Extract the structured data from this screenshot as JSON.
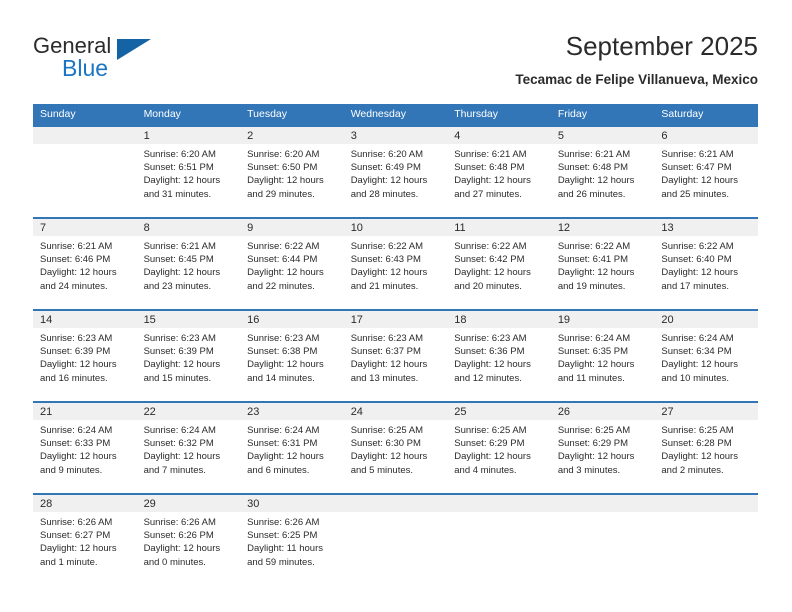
{
  "logo": {
    "word_top": "General",
    "word_bottom": "Blue",
    "triangle_color": "#1464a5",
    "blue_color": "#1a75c4"
  },
  "header": {
    "title": "September 2025",
    "subtitle": "Tecamac de Felipe Villanueva, Mexico"
  },
  "theme": {
    "header_blue": "#3276b8",
    "daynum_band": "#f0f0f0",
    "text": "#2b2b2b"
  },
  "weekday_headers": [
    "Sunday",
    "Monday",
    "Tuesday",
    "Wednesday",
    "Thursday",
    "Friday",
    "Saturday"
  ],
  "weeks": [
    [
      {
        "day": "",
        "sunrise": "",
        "sunset": "",
        "daylight1": "",
        "daylight2": ""
      },
      {
        "day": "1",
        "sunrise": "Sunrise: 6:20 AM",
        "sunset": "Sunset: 6:51 PM",
        "daylight1": "Daylight: 12 hours",
        "daylight2": "and 31 minutes."
      },
      {
        "day": "2",
        "sunrise": "Sunrise: 6:20 AM",
        "sunset": "Sunset: 6:50 PM",
        "daylight1": "Daylight: 12 hours",
        "daylight2": "and 29 minutes."
      },
      {
        "day": "3",
        "sunrise": "Sunrise: 6:20 AM",
        "sunset": "Sunset: 6:49 PM",
        "daylight1": "Daylight: 12 hours",
        "daylight2": "and 28 minutes."
      },
      {
        "day": "4",
        "sunrise": "Sunrise: 6:21 AM",
        "sunset": "Sunset: 6:48 PM",
        "daylight1": "Daylight: 12 hours",
        "daylight2": "and 27 minutes."
      },
      {
        "day": "5",
        "sunrise": "Sunrise: 6:21 AM",
        "sunset": "Sunset: 6:48 PM",
        "daylight1": "Daylight: 12 hours",
        "daylight2": "and 26 minutes."
      },
      {
        "day": "6",
        "sunrise": "Sunrise: 6:21 AM",
        "sunset": "Sunset: 6:47 PM",
        "daylight1": "Daylight: 12 hours",
        "daylight2": "and 25 minutes."
      }
    ],
    [
      {
        "day": "7",
        "sunrise": "Sunrise: 6:21 AM",
        "sunset": "Sunset: 6:46 PM",
        "daylight1": "Daylight: 12 hours",
        "daylight2": "and 24 minutes."
      },
      {
        "day": "8",
        "sunrise": "Sunrise: 6:21 AM",
        "sunset": "Sunset: 6:45 PM",
        "daylight1": "Daylight: 12 hours",
        "daylight2": "and 23 minutes."
      },
      {
        "day": "9",
        "sunrise": "Sunrise: 6:22 AM",
        "sunset": "Sunset: 6:44 PM",
        "daylight1": "Daylight: 12 hours",
        "daylight2": "and 22 minutes."
      },
      {
        "day": "10",
        "sunrise": "Sunrise: 6:22 AM",
        "sunset": "Sunset: 6:43 PM",
        "daylight1": "Daylight: 12 hours",
        "daylight2": "and 21 minutes."
      },
      {
        "day": "11",
        "sunrise": "Sunrise: 6:22 AM",
        "sunset": "Sunset: 6:42 PM",
        "daylight1": "Daylight: 12 hours",
        "daylight2": "and 20 minutes."
      },
      {
        "day": "12",
        "sunrise": "Sunrise: 6:22 AM",
        "sunset": "Sunset: 6:41 PM",
        "daylight1": "Daylight: 12 hours",
        "daylight2": "and 19 minutes."
      },
      {
        "day": "13",
        "sunrise": "Sunrise: 6:22 AM",
        "sunset": "Sunset: 6:40 PM",
        "daylight1": "Daylight: 12 hours",
        "daylight2": "and 17 minutes."
      }
    ],
    [
      {
        "day": "14",
        "sunrise": "Sunrise: 6:23 AM",
        "sunset": "Sunset: 6:39 PM",
        "daylight1": "Daylight: 12 hours",
        "daylight2": "and 16 minutes."
      },
      {
        "day": "15",
        "sunrise": "Sunrise: 6:23 AM",
        "sunset": "Sunset: 6:39 PM",
        "daylight1": "Daylight: 12 hours",
        "daylight2": "and 15 minutes."
      },
      {
        "day": "16",
        "sunrise": "Sunrise: 6:23 AM",
        "sunset": "Sunset: 6:38 PM",
        "daylight1": "Daylight: 12 hours",
        "daylight2": "and 14 minutes."
      },
      {
        "day": "17",
        "sunrise": "Sunrise: 6:23 AM",
        "sunset": "Sunset: 6:37 PM",
        "daylight1": "Daylight: 12 hours",
        "daylight2": "and 13 minutes."
      },
      {
        "day": "18",
        "sunrise": "Sunrise: 6:23 AM",
        "sunset": "Sunset: 6:36 PM",
        "daylight1": "Daylight: 12 hours",
        "daylight2": "and 12 minutes."
      },
      {
        "day": "19",
        "sunrise": "Sunrise: 6:24 AM",
        "sunset": "Sunset: 6:35 PM",
        "daylight1": "Daylight: 12 hours",
        "daylight2": "and 11 minutes."
      },
      {
        "day": "20",
        "sunrise": "Sunrise: 6:24 AM",
        "sunset": "Sunset: 6:34 PM",
        "daylight1": "Daylight: 12 hours",
        "daylight2": "and 10 minutes."
      }
    ],
    [
      {
        "day": "21",
        "sunrise": "Sunrise: 6:24 AM",
        "sunset": "Sunset: 6:33 PM",
        "daylight1": "Daylight: 12 hours",
        "daylight2": "and 9 minutes."
      },
      {
        "day": "22",
        "sunrise": "Sunrise: 6:24 AM",
        "sunset": "Sunset: 6:32 PM",
        "daylight1": "Daylight: 12 hours",
        "daylight2": "and 7 minutes."
      },
      {
        "day": "23",
        "sunrise": "Sunrise: 6:24 AM",
        "sunset": "Sunset: 6:31 PM",
        "daylight1": "Daylight: 12 hours",
        "daylight2": "and 6 minutes."
      },
      {
        "day": "24",
        "sunrise": "Sunrise: 6:25 AM",
        "sunset": "Sunset: 6:30 PM",
        "daylight1": "Daylight: 12 hours",
        "daylight2": "and 5 minutes."
      },
      {
        "day": "25",
        "sunrise": "Sunrise: 6:25 AM",
        "sunset": "Sunset: 6:29 PM",
        "daylight1": "Daylight: 12 hours",
        "daylight2": "and 4 minutes."
      },
      {
        "day": "26",
        "sunrise": "Sunrise: 6:25 AM",
        "sunset": "Sunset: 6:29 PM",
        "daylight1": "Daylight: 12 hours",
        "daylight2": "and 3 minutes."
      },
      {
        "day": "27",
        "sunrise": "Sunrise: 6:25 AM",
        "sunset": "Sunset: 6:28 PM",
        "daylight1": "Daylight: 12 hours",
        "daylight2": "and 2 minutes."
      }
    ],
    [
      {
        "day": "28",
        "sunrise": "Sunrise: 6:26 AM",
        "sunset": "Sunset: 6:27 PM",
        "daylight1": "Daylight: 12 hours",
        "daylight2": "and 1 minute."
      },
      {
        "day": "29",
        "sunrise": "Sunrise: 6:26 AM",
        "sunset": "Sunset: 6:26 PM",
        "daylight1": "Daylight: 12 hours",
        "daylight2": "and 0 minutes."
      },
      {
        "day": "30",
        "sunrise": "Sunrise: 6:26 AM",
        "sunset": "Sunset: 6:25 PM",
        "daylight1": "Daylight: 11 hours",
        "daylight2": "and 59 minutes."
      },
      {
        "day": "",
        "sunrise": "",
        "sunset": "",
        "daylight1": "",
        "daylight2": ""
      },
      {
        "day": "",
        "sunrise": "",
        "sunset": "",
        "daylight1": "",
        "daylight2": ""
      },
      {
        "day": "",
        "sunrise": "",
        "sunset": "",
        "daylight1": "",
        "daylight2": ""
      },
      {
        "day": "",
        "sunrise": "",
        "sunset": "",
        "daylight1": "",
        "daylight2": ""
      }
    ]
  ]
}
